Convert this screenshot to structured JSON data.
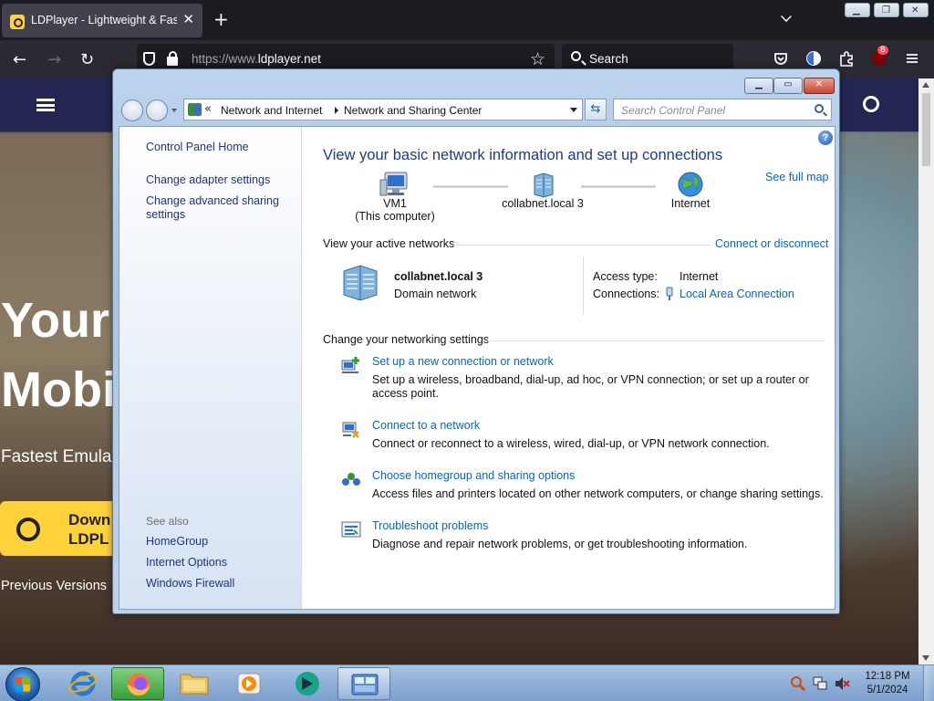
{
  "browser": {
    "tab_title": "LDPlayer - Lightweight & Fast Android Emulator",
    "tab_close": "✕",
    "newtab_label": "+",
    "url_prefix": "https://www.",
    "url_host": "ldplayer.net",
    "search_placeholder": "Search",
    "extensions_badge": "8"
  },
  "webpage": {
    "hero_line1": "Your",
    "hero_line2": "Mobi",
    "hero_sub": "Fastest Emula",
    "download_line1": "Down",
    "download_line2": "LDPL",
    "previous_versions": "Previous Versions ❯"
  },
  "window": {
    "address": {
      "crumb1": "Network and Internet",
      "crumb2": "Network and Sharing Center",
      "overflow": "«"
    },
    "search_placeholder": "Search Control Panel",
    "left_panel": {
      "home": "Control Panel Home",
      "links": [
        "Change adapter settings",
        "Change advanced sharing settings"
      ],
      "see_also_header": "See also",
      "see_also": [
        "HomeGroup",
        "Internet Options",
        "Windows Firewall"
      ]
    },
    "main": {
      "title": "View your basic network information and set up connections",
      "see_full_map": "See full map",
      "map": {
        "computer_name": "VM1",
        "computer_sub": "(This computer)",
        "network_name": "collabnet.local  3",
        "internet": "Internet"
      },
      "active_networks_header": "View your active networks",
      "connect_or_disconnect": "Connect or disconnect",
      "active_network": {
        "name": "collabnet.local  3",
        "type": "Domain network",
        "access_type_label": "Access type:",
        "access_type_value": "Internet",
        "connections_label": "Connections:",
        "connections_value": "Local Area Connection"
      },
      "change_settings_header": "Change your networking settings",
      "tasks": [
        {
          "link": "Set up a new connection or network",
          "desc": "Set up a wireless, broadband, dial-up, ad hoc, or VPN connection; or set up a router or access point."
        },
        {
          "link": "Connect to a network",
          "desc": "Connect or reconnect to a wireless, wired, dial-up, or VPN network connection."
        },
        {
          "link": "Choose homegroup and sharing options",
          "desc": "Access files and printers located on other network computers, or change sharing settings."
        },
        {
          "link": "Troubleshoot problems",
          "desc": "Diagnose and repair network problems, or get troubleshooting information."
        }
      ]
    }
  },
  "taskbar": {
    "items": [
      "internet-explorer",
      "firefox",
      "file-explorer",
      "media-player",
      "ldplayer",
      "control-panel"
    ],
    "time": "12:18 PM",
    "date": "5/1/2024"
  }
}
